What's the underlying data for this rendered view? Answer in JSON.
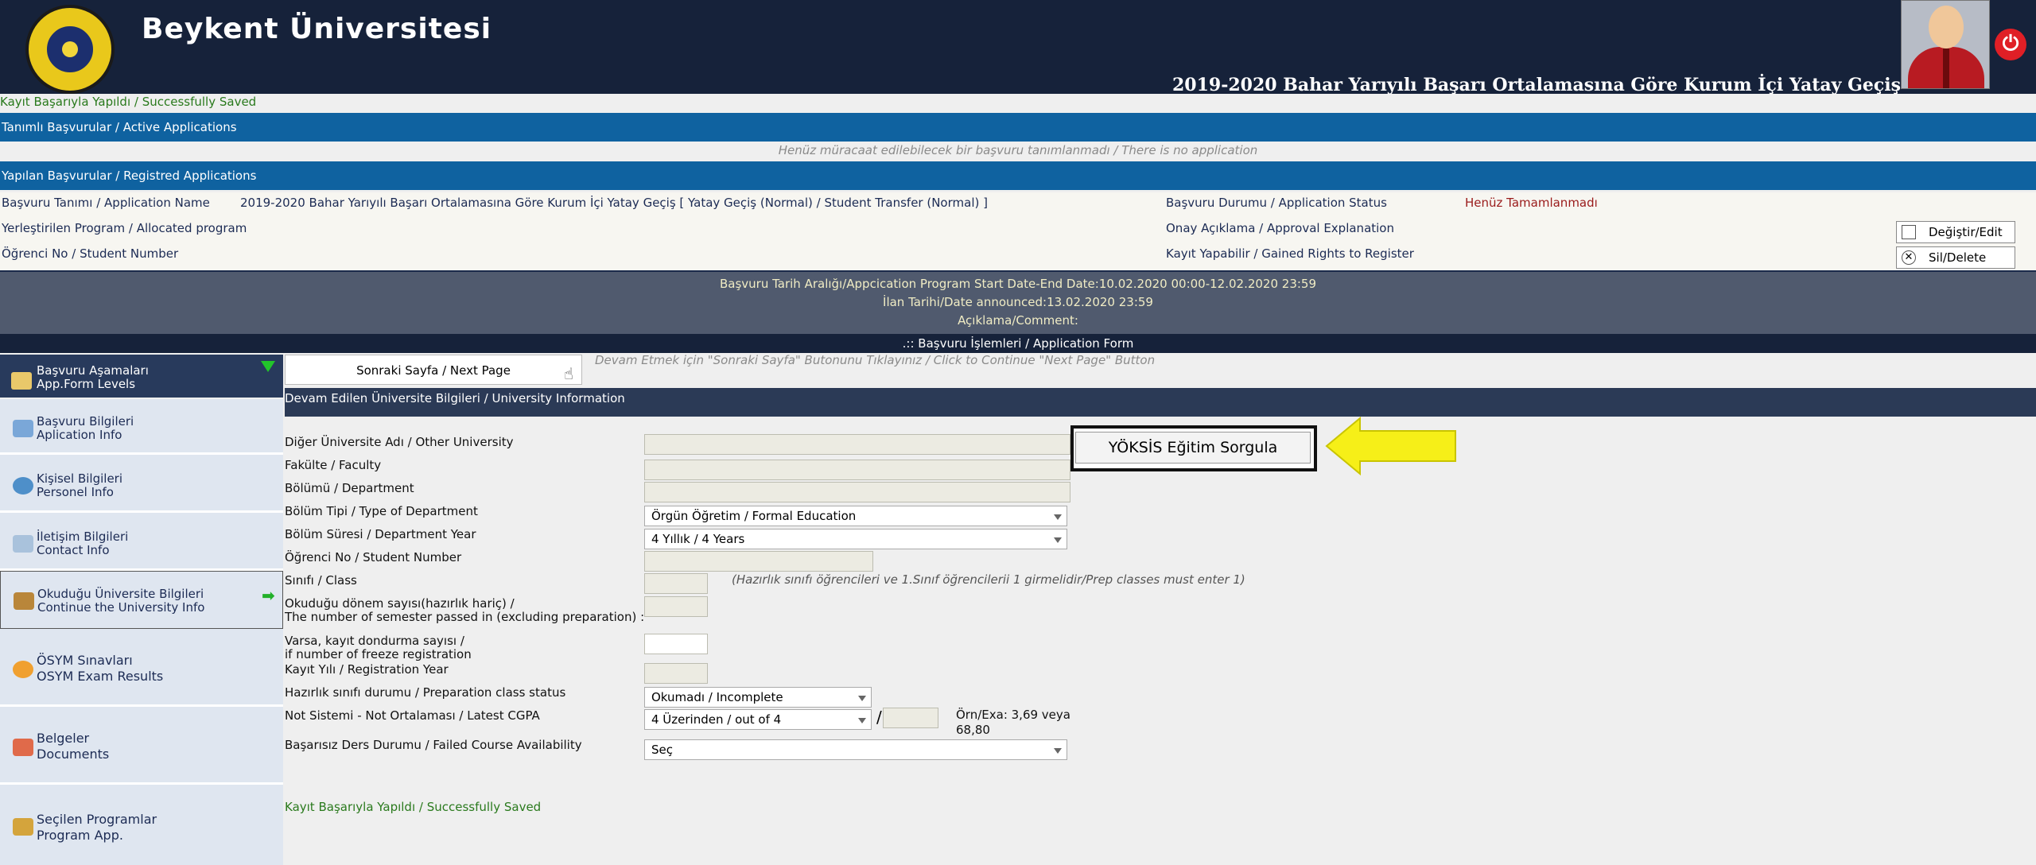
{
  "header": {
    "site_title": "Beykent Üniversitesi",
    "program_title": "2019-2020 Bahar Yarıyılı Başarı Ortalamasına Göre Kurum İçi Yatay Geçiş",
    "colors": {
      "header_bg": "#16223a",
      "band_blue": "#0f62a0",
      "sidebar_bg": "#dfe6f0"
    }
  },
  "messages": {
    "saved": "Kayıt Başarıyla Yapıldı / Successfully Saved",
    "no_application": "Henüz müracaat edilebilecek bir başvuru tanımlanmadı / There is no application",
    "continue_hint": "Devam Etmek için \"Sonraki Sayfa\" Butonunu Tıklayınız / Click to Continue \"Next Page\" Button",
    "class_hint": "(Hazırlık sınıfı öğrencileri ve 1.Sınıf öğrencilerii 1 girmelidir/Prep classes must enter 1)"
  },
  "bands": {
    "active": "Tanımlı Başvurular / Active Applications",
    "registered": "Yapılan Başvurular / Registred Applications",
    "form": ".:: Başvuru İşlemleri / Application Form",
    "university_info": "Devam Edilen Üniversite Bilgileri / University Information"
  },
  "registered": {
    "app_name_label": "Başvuru Tanımı / Application Name",
    "app_name_value": "2019-2020 Bahar Yarıyılı Başarı Ortalamasına Göre Kurum İçi Yatay Geçiş   [ Yatay Geçiş (Normal) / Student Transfer (Normal) ]",
    "allocated_label": "Yerleştirilen Program / Allocated program",
    "student_no_label": "Öğrenci No / Student Number",
    "status_label": "Başvuru Durumu / Application Status",
    "status_value": "Henüz Tamamlanmadı",
    "approval_label": "Onay Açıklama / Approval Explanation",
    "rights_label": "Kayıt Yapabilir / Gained Rights to Register",
    "edit_button": "Değiştir/Edit",
    "delete_button": "Sil/Delete"
  },
  "dates": {
    "line1": "Başvuru Tarih Aralığı/Appcication Program Start Date-End Date:10.02.2020 00:00-12.02.2020 23:59",
    "line2": "İlan Tarihi/Date announced:13.02.2020 23:59",
    "line3": "Açıklama/Comment:"
  },
  "sidebar": {
    "head_line1": "Başvuru Aşamaları",
    "head_line2": "App.Form Levels",
    "items": [
      {
        "line1": "Başvuru Bilgileri",
        "line2": "Aplication Info"
      },
      {
        "line1": "Kişisel Bilgileri",
        "line2": "Personel Info"
      },
      {
        "line1": "İletişim Bilgileri",
        "line2": "Contact Info"
      },
      {
        "line1": "Okuduğu Üniversite Bilgileri",
        "line2": "Continue the University Info"
      },
      {
        "line1": "ÖSYM Sınavları",
        "line2": "OSYM Exam Results"
      },
      {
        "line1": "Belgeler",
        "line2": "Documents"
      },
      {
        "line1": "Seçilen Programlar",
        "line2": "Program App."
      }
    ]
  },
  "form": {
    "next_button": "Sonraki Sayfa / Next Page",
    "yoksis_button": "YÖKSİS Eğitim Sorgula",
    "labels": {
      "other_university": "Diğer Üniversite Adı / Other University",
      "faculty": "Fakülte / Faculty",
      "department": "Bölümü / Department",
      "dept_type": "Bölüm Tipi / Type of Department",
      "dept_year": "Bölüm Süresi / Department Year",
      "student_no": "Öğrenci No / Student Number",
      "class": "Sınıfı / Class",
      "semesters_1": "Okuduğu dönem sayısı(hazırlık hariç) /",
      "semesters_2": "The number of semester passed in (excluding preparation) :",
      "freeze_1": "Varsa, kayıt dondurma sayısı /",
      "freeze_2": "if number of freeze registration",
      "reg_year": "Kayıt Yılı / Registration Year",
      "prep_status": "Hazırlık sınıfı durumu / Preparation class status",
      "gpa": "Not Sistemi - Not Ortalaması / Latest CGPA",
      "failed": "Başarısız Ders Durumu / Failed Course Availability"
    },
    "values": {
      "dept_type": "Örgün Öğretim / Formal Education",
      "dept_year": "4 Yıllık / 4 Years",
      "prep_status": "Okumadı / Incomplete",
      "gpa_system": "4 Üzerinden / out of 4",
      "failed": "Seç"
    },
    "example_1": "Örn/Exa: 3,69 veya",
    "example_2": "68,80",
    "slash": "/"
  }
}
